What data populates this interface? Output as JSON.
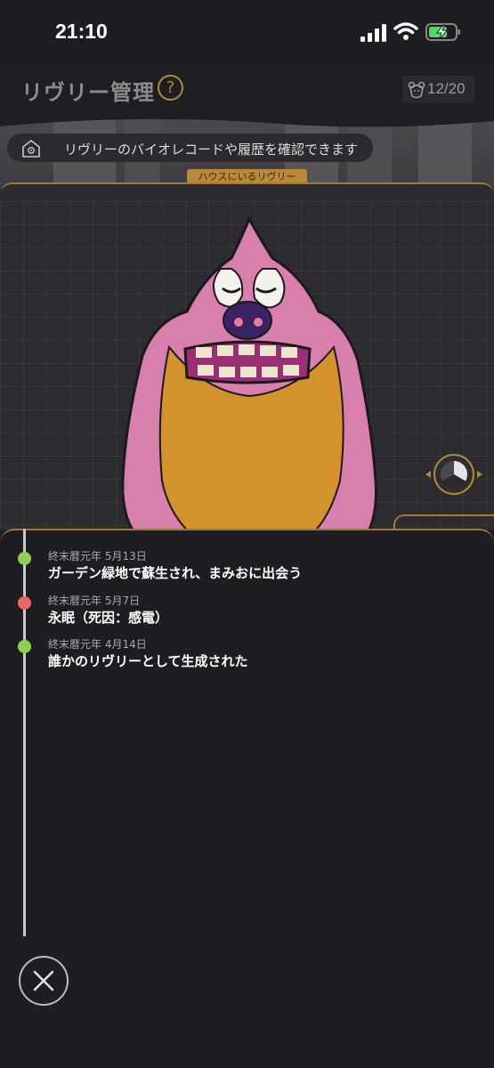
{
  "status_bar": {
    "time": "21:10"
  },
  "header": {
    "title": "リヴリー管理",
    "help_label": "?",
    "count": "12/20"
  },
  "banner": {
    "tip": "リヴリーのバイオレコードや履歴を確認できます",
    "house_label": "ハウスにいるリヴリー"
  },
  "timeline": [
    {
      "date": "終末暦元年 5月13日",
      "text": "ガーデン緑地で蘇生され、まみおに出会う",
      "status": "green"
    },
    {
      "date": "終末暦元年 5月7日",
      "text": "永眠（死因：感電）",
      "status": "red"
    },
    {
      "date": "終末暦元年 4月14日",
      "text": "誰かのリヴリーとして生成された",
      "status": "green"
    }
  ],
  "colors": {
    "accent": "#a27a35",
    "alive": "#8fd14f",
    "dead": "#e9695f",
    "creature_body": "#d97fae",
    "creature_belly": "#d4922d"
  },
  "icons": [
    "signal-icon",
    "wifi-icon",
    "battery-charging-icon",
    "help-icon",
    "bear-icon",
    "house-icon",
    "rotate-view-icon",
    "close-icon"
  ]
}
